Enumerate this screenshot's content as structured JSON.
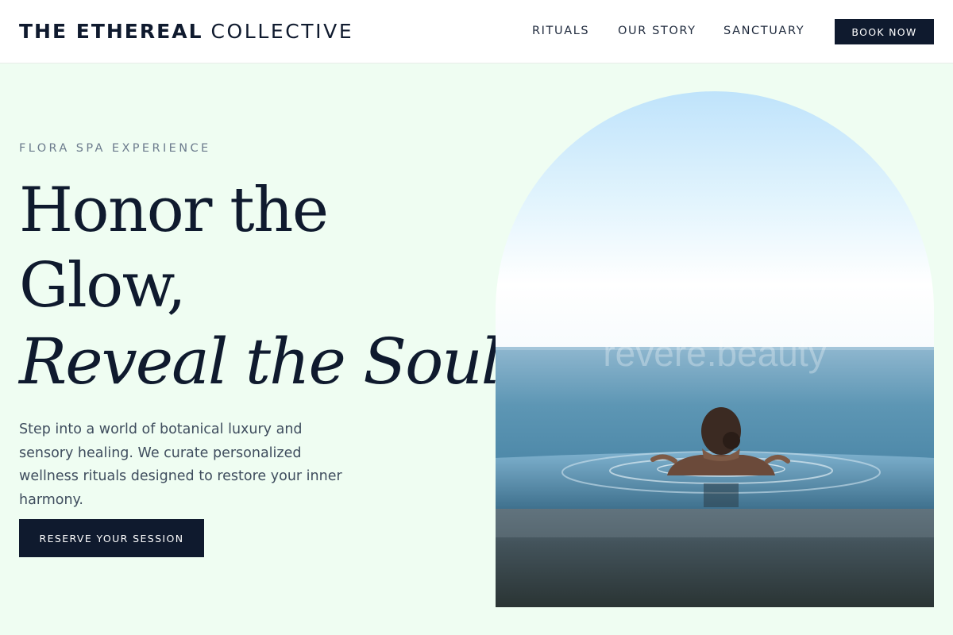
{
  "brand": {
    "name_strong": "THE ETHEREAL",
    "name_light": "COLLECTIVE"
  },
  "nav": {
    "links": [
      "RITUALS",
      "OUR STORY",
      "SANCTUARY"
    ],
    "book_label": "BOOK NOW"
  },
  "hero": {
    "eyebrow": "FLORA SPA EXPERIENCE",
    "headline_line1": "Honor the",
    "headline_line2": "Glow,",
    "headline_line3": "Reveal the Soul.",
    "body": "Step into a world of botanical luxury and sensory healing. We curate personalized wellness rituals designed to restore your inner harmony.",
    "cta_label": "RESERVE YOUR SESSION"
  },
  "image": {
    "watermark": "revere.beauty"
  },
  "colors": {
    "background": "#effdf2",
    "navy": "#0f1a2e",
    "muted": "#6c7b8d",
    "body_text": "#3f4d5e"
  }
}
